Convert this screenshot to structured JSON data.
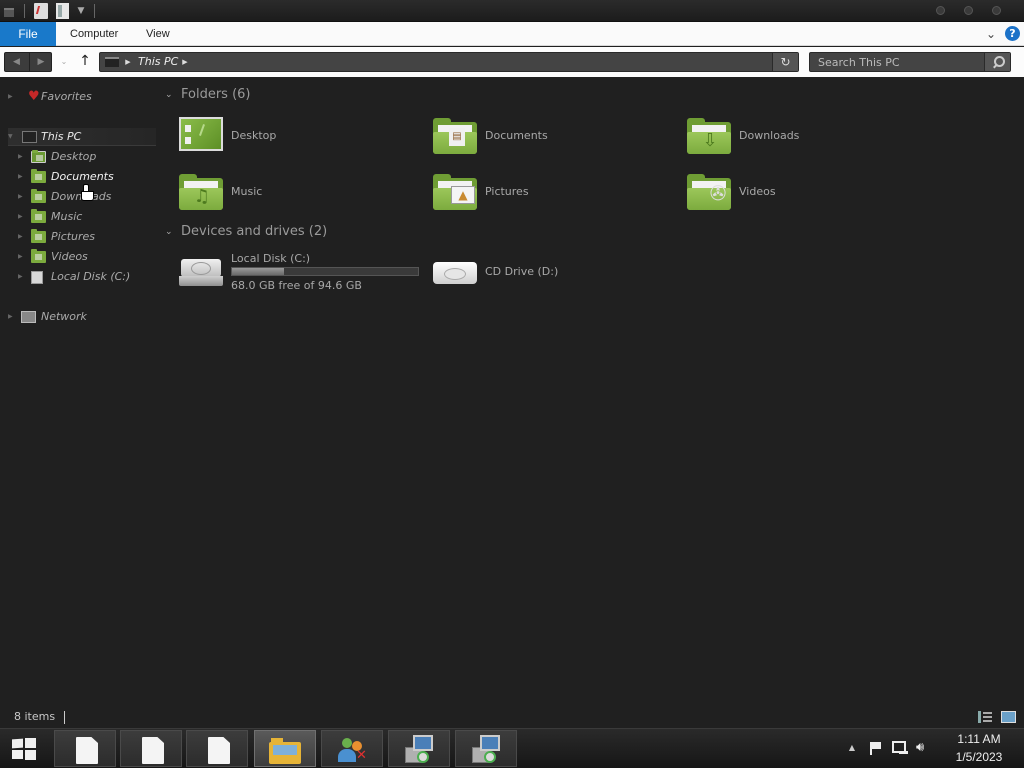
{
  "ribbon": {
    "tabs": [
      "File",
      "Computer",
      "View"
    ]
  },
  "navbar": {
    "address_location": "This PC",
    "search_placeholder": "Search This PC"
  },
  "navpane": {
    "favorites": "Favorites",
    "this_pc": "This PC",
    "children": [
      "Desktop",
      "Documents",
      "Downloads",
      "Music",
      "Pictures",
      "Videos",
      "Local Disk (C:)"
    ],
    "network": "Network"
  },
  "content": {
    "folders_header": "Folders (6)",
    "folders": [
      {
        "label": "Desktop",
        "icon": "desktop-folder-icon"
      },
      {
        "label": "Documents",
        "icon": "documents-folder-icon"
      },
      {
        "label": "Downloads",
        "icon": "downloads-folder-icon"
      },
      {
        "label": "Music",
        "icon": "music-folder-icon"
      },
      {
        "label": "Pictures",
        "icon": "pictures-folder-icon"
      },
      {
        "label": "Videos",
        "icon": "videos-folder-icon"
      }
    ],
    "devices_header": "Devices and drives (2)",
    "drives": [
      {
        "label": "Local Disk (C:)",
        "free_text": "68.0 GB free of 94.6 GB",
        "used_fraction": 0.28
      },
      {
        "label": "CD Drive (D:)"
      }
    ]
  },
  "status": {
    "item_count": "8 items"
  },
  "taskbar": {
    "time": "1:11 AM",
    "date": "1/5/2023"
  },
  "colors": {
    "file_tab": "#1979ca",
    "folder_green": "#7cab3e",
    "background": "#202020"
  }
}
